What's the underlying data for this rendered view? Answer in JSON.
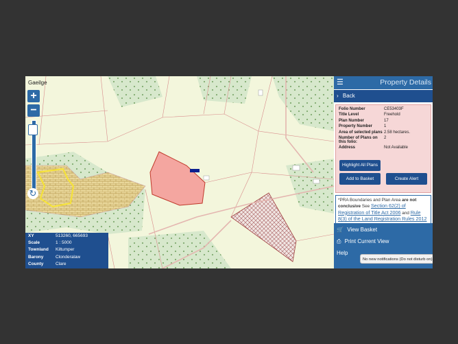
{
  "map": {
    "language_link": "Gaeilge",
    "zoom_in": "+",
    "zoom_out": "−",
    "refresh_icon": "↻",
    "info_box": [
      {
        "key": "XY",
        "value": "513260, 665693"
      },
      {
        "key": "Scale",
        "value": "1 : 5000"
      },
      {
        "key": "Townland",
        "value": "Kiltumper"
      },
      {
        "key": "Barony",
        "value": "Clonderalaw"
      },
      {
        "key": "County",
        "value": "Clare"
      }
    ]
  },
  "panel": {
    "menu_icon": "☰",
    "title": "Property Details",
    "back_label": "Back",
    "details": [
      {
        "key": "Folio Number",
        "value": "CE53403F"
      },
      {
        "key": "Title Level",
        "value": "Freehold"
      },
      {
        "key": "Plan Number",
        "value": "17"
      },
      {
        "key": "Property Number",
        "value": "1"
      },
      {
        "key": "Area of selected plans",
        "value": "2.58 hectares."
      },
      {
        "key": "Number of Plans on this folio:",
        "value": "2"
      },
      {
        "key": "Address",
        "value": "Not Available"
      }
    ],
    "highlight_button": "Highlight All Plans",
    "basket_button": "Add to Basket",
    "alert_button": "Create Alert",
    "notice": {
      "prefix": "*PRA Boundaries and Plan Area",
      "bold": "are not conclusive",
      "see": "See",
      "link1": "Section 62(2) of Registration of Title Act 2006",
      "and": "and",
      "link2": "Rule 8(3) of the Land Registration Rules 2012"
    },
    "view_basket": "View Basket",
    "print_view": "Print Current View",
    "help": "Help",
    "toast": "No new notifications (Do not disturb on)"
  },
  "colors": {
    "primary": "#2d6aa6",
    "dark": "#1f4f8f",
    "selected_plot": "#f4a6a0",
    "details_bg": "#f6d7d7"
  }
}
